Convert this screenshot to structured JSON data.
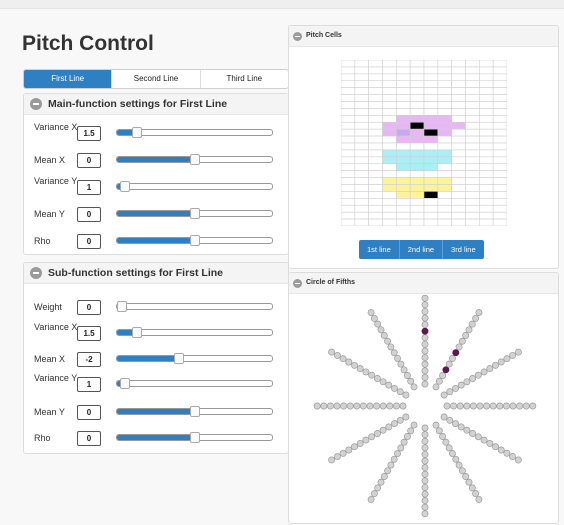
{
  "header": {
    "title": "Pitch Control"
  },
  "tabs": [
    {
      "label": "First Line",
      "active": true
    },
    {
      "label": "Second Line",
      "active": false
    },
    {
      "label": "Third Line",
      "active": false
    }
  ],
  "main_panel": {
    "title": "Main-function settings for First Line",
    "rows": [
      {
        "label": "Variance X",
        "value": "1.5",
        "level": 0.13
      },
      {
        "label": "Mean X",
        "value": "0",
        "level": 0.5
      },
      {
        "label": "Variance Y",
        "value": "1",
        "level": 0.05
      },
      {
        "label": "Mean Y",
        "value": "0",
        "level": 0.5
      },
      {
        "label": "Rho",
        "value": "0",
        "level": 0.5
      }
    ]
  },
  "sub_panel": {
    "title": "Sub-function settings for First Line",
    "rows": [
      {
        "label": "Weight",
        "value": "0",
        "level": 0.0
      },
      {
        "label": "Variance X",
        "value": "1.5",
        "level": 0.13
      },
      {
        "label": "Mean X",
        "value": "-2",
        "level": 0.4
      },
      {
        "label": "Variance Y",
        "value": "1",
        "level": 0.05
      },
      {
        "label": "Mean Y",
        "value": "0",
        "level": 0.5
      },
      {
        "label": "Rho",
        "value": "0",
        "level": 0.5
      }
    ]
  },
  "pitch_cells": {
    "title": "Pitch Cells",
    "line_buttons": [
      "1st line",
      "2nd line",
      "3rd line"
    ],
    "colors": {
      "line1": "#e8b6f5",
      "line2": "#a8f0f5",
      "line3": "#fff39a",
      "peak": "#000000"
    }
  },
  "circle_panel": {
    "title": "Circle of Fifths",
    "colors": {
      "node": "#d2d2d2",
      "node_stroke": "#9b9b9b",
      "active": "#5a1a4e"
    }
  },
  "accent": "#2f7fc3"
}
